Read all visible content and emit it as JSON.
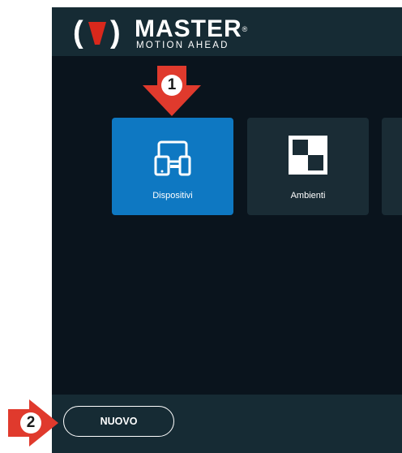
{
  "header": {
    "logo_word": "MASTER",
    "logo_tagline": "MOTION AHEAD",
    "logo_reg": "®"
  },
  "tiles": [
    {
      "label": "Dispositivi",
      "icon": "devices-icon",
      "selected": true
    },
    {
      "label": "Ambienti",
      "icon": "rooms-checker-icon",
      "selected": false
    }
  ],
  "footer": {
    "new_label": "NUOVO"
  },
  "callouts": [
    {
      "number": "1",
      "points_to": "Dispositivi"
    },
    {
      "number": "2",
      "points_to": "NUOVO"
    }
  ],
  "colors": {
    "app_bg": "#0a141d",
    "header_bg": "#162b34",
    "tile_selected": "#0e78c2",
    "tile_default": "#1a2c35",
    "callout_red": "#e03a2d",
    "logo_red": "#d9281c"
  }
}
